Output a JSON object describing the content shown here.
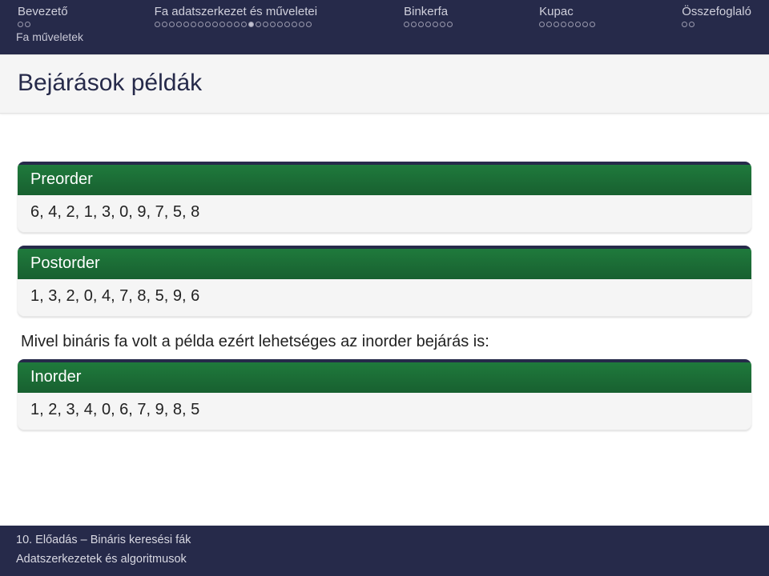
{
  "header": {
    "nav": [
      {
        "label": "Bevezető",
        "dots": 2,
        "filled": []
      },
      {
        "label": "Fa adatszerkezet és műveletei",
        "dots": 22,
        "filled": [
          13
        ]
      },
      {
        "label": "Binkerfa",
        "dots": 7,
        "filled": []
      },
      {
        "label": "Kupac",
        "dots": 8,
        "filled": []
      },
      {
        "label": "Összefoglaló",
        "dots": 2,
        "filled": []
      }
    ],
    "sublabel": "Fa műveletek"
  },
  "title": "Bejárások példák",
  "blocks": {
    "preorder": {
      "title": "Preorder",
      "body": "6, 4, 2, 1, 3, 0, 9, 7, 5, 8"
    },
    "postorder": {
      "title": "Postorder",
      "body": "1, 3, 2, 0, 4, 7, 8, 5, 9, 6"
    },
    "inorder": {
      "title": "Inorder",
      "body": "1, 2, 3, 4, 0, 6, 7, 9, 8, 5"
    }
  },
  "midtext": "Mivel bináris fa volt a példa ezért lehetséges az inorder bejárás is:",
  "footer": {
    "line1": "10. Előadás – Bináris keresési fák",
    "line2": "Adatszerkezetek és algoritmusok"
  }
}
